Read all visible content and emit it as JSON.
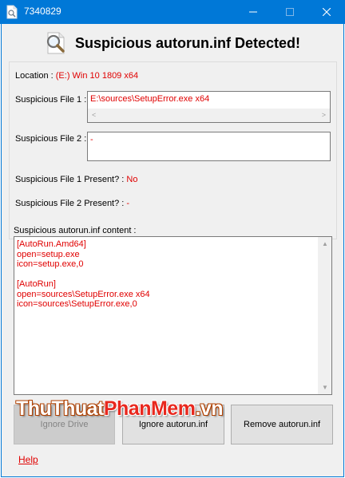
{
  "window": {
    "title": "7340829",
    "minimize_glyph": "—",
    "close_glyph": "✕",
    "icon": "document-icon"
  },
  "header": {
    "title": "Suspicious autorun.inf Detected!",
    "icon": "magnifier-icon"
  },
  "info": {
    "location_label": "Location :",
    "location_value": "(E:) Win 10 1809 x64",
    "file1_label": "Suspicious File 1 :",
    "file1_value": "E:\\sources\\SetupError.exe x64",
    "file2_label": "Suspicious File 2 :",
    "file2_value": "-",
    "file1_present_label": "Suspicious File 1 Present? :",
    "file1_present_value": "No",
    "file2_present_label": "Suspicious File 2 Present? :",
    "file2_present_value": "-"
  },
  "content": {
    "label": "Suspicious autorun.inf content :",
    "lines": [
      "[AutoRun.Amd64]",
      "open=setup.exe",
      "icon=setup.exe,0",
      "",
      "[AutoRun]",
      "open=sources\\SetupError.exe x64",
      "icon=sources\\SetupError.exe,0"
    ]
  },
  "buttons": {
    "ignore_drive": "Ignore Drive",
    "ignore_autorun": "Ignore autorun.inf",
    "remove_autorun": "Remove autorun.inf"
  },
  "watermark": {
    "part1": "ThuThuat",
    "part2": "PhanMem",
    "part3": ".vn"
  },
  "help": {
    "label": "Help"
  },
  "colors": {
    "titlebar": "#0078d7",
    "value_text": "#e00000",
    "window_bg": "#f0f0f0"
  }
}
